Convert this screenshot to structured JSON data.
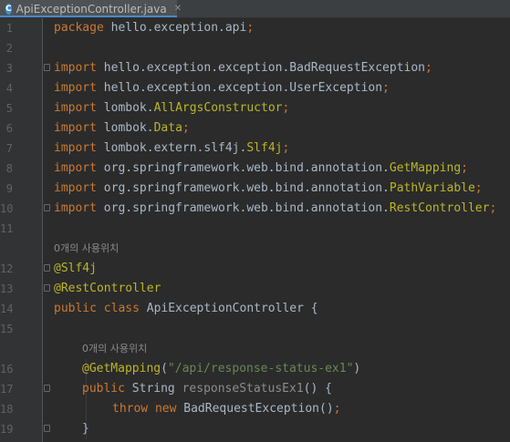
{
  "tab": {
    "filename": "ApiExceptionController.java",
    "icon": "C",
    "close": "✕"
  },
  "hints": {
    "usages_1": "0개의 사용위치",
    "usages_2": "0개의 사용위치"
  },
  "lines": {
    "l1": {
      "num": "1",
      "kw": "package",
      "rest": " hello.exception.api",
      "semi": ";"
    },
    "l2": {
      "num": "2"
    },
    "l3": {
      "num": "3",
      "kw": "import",
      "pkg": " hello.exception.exception.",
      "cls": "BadRequestException",
      "semi": ";"
    },
    "l4": {
      "num": "4",
      "kw": "import",
      "pkg": " hello.exception.exception.",
      "cls": "UserException",
      "semi": ";"
    },
    "l5": {
      "num": "5",
      "kw": "import",
      "pkg": " lombok.",
      "cls": "AllArgsConstructor",
      "semi": ";"
    },
    "l6": {
      "num": "6",
      "kw": "import",
      "pkg": " lombok.",
      "cls": "Data",
      "semi": ";"
    },
    "l7": {
      "num": "7",
      "kw": "import",
      "pkg": " lombok.extern.slf4j.",
      "cls": "Slf4j",
      "semi": ";"
    },
    "l8": {
      "num": "8",
      "kw": "import",
      "pkg": " org.springframework.web.bind.annotation.",
      "cls": "GetMapping",
      "semi": ";"
    },
    "l9": {
      "num": "9",
      "kw": "import",
      "pkg": " org.springframework.web.bind.annotation.",
      "cls": "PathVariable",
      "semi": ";"
    },
    "l10": {
      "num": "10",
      "kw": "import",
      "pkg": " org.springframework.web.bind.annotation.",
      "cls": "RestController",
      "semi": ";"
    },
    "l11": {
      "num": "11"
    },
    "l12": {
      "num": "12",
      "ann": "@Slf4j"
    },
    "l13": {
      "num": "13",
      "ann": "@RestController"
    },
    "l14": {
      "num": "14",
      "kw": "public class",
      "rest": " ApiExceptionController {"
    },
    "l15": {
      "num": "15"
    },
    "l16": {
      "num": "16",
      "ann": "@GetMapping",
      "open": "(",
      "str": "\"/api/response-status-ex1\"",
      "close": ")"
    },
    "l17": {
      "num": "17",
      "kw": "public",
      "type": " String ",
      "name": "responseStatusEx1",
      "rest": "() {"
    },
    "l18": {
      "num": "18",
      "kw": "throw new",
      "rest": " BadRequestException()",
      "semi": ";"
    },
    "l19": {
      "num": "19",
      "rest": "}"
    }
  }
}
